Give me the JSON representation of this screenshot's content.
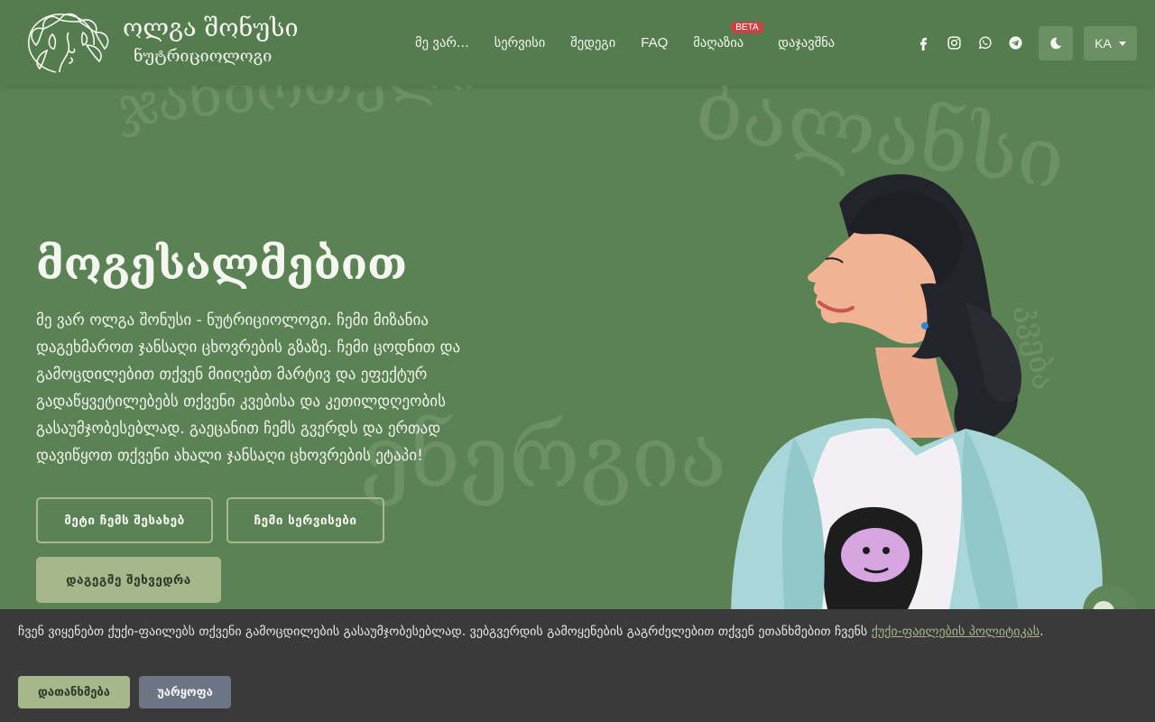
{
  "header": {
    "logo_name": "ოლგა შონუსი",
    "logo_subtitle": "ნუტრიციოლოგი",
    "nav": [
      {
        "label": "მე ვარ..."
      },
      {
        "label": "სერვისი"
      },
      {
        "label": "შედეგი"
      },
      {
        "label": "FAQ"
      },
      {
        "label": "მაღაზია",
        "badge": "BETA"
      },
      {
        "label": "დაჯავშნა"
      }
    ],
    "social_icons": [
      "facebook-icon",
      "instagram-icon",
      "whatsapp-icon",
      "telegram-icon"
    ],
    "theme_icon": "moon-icon",
    "language": "KA"
  },
  "background_words": [
    "ჯანმრთელი",
    "ბალანსი",
    "კვება",
    "ენერგია"
  ],
  "hero": {
    "title": "მოგესალმებით",
    "text": "მე ვარ ოლგა შონუსი - ნუტრიციოლოგი. ჩემი მიზანია დაგეხმაროთ ჯანსაღი ცხოვრების გზაზე. ჩემი ცოდნით და გამოცდილებით თქვენ მიიღებთ მარტივ და ეფექტურ გადაწყვეტილებებს თქვენი კვებისა და კეთილდღეობის გასაუმჯობესებლად. გაეცანით ჩემს გვერდს და ერთად დავიწყოთ თქვენი ახალი ჯანსაღი ცხოვრების ეტაპი!",
    "buttons": {
      "about": "მეტი ჩემს შესახებ",
      "services": "ჩემი სერვისები",
      "book": "დაგეგმე შეხვედრა"
    }
  },
  "cookie": {
    "text": "ჩვენ ვიყენებთ ქუქი-ფაილებს თქვენი გამოცდილების გასაუმჯობესებლად. ვებგვერდის გამოყენების გაგრძელებით თქვენ ეთანხმებით ჩვენს ",
    "link": "ქუქი-ფაილების პოლიტიკას",
    "end": ".",
    "accept": "დათანხმება",
    "decline": "უარყოფა"
  },
  "colors": {
    "background": "#5b8254",
    "header": "#557c4f",
    "accent": "#a7b78c",
    "cookie_bg": "#3a3a3a",
    "beta_badge": "#c84444"
  }
}
